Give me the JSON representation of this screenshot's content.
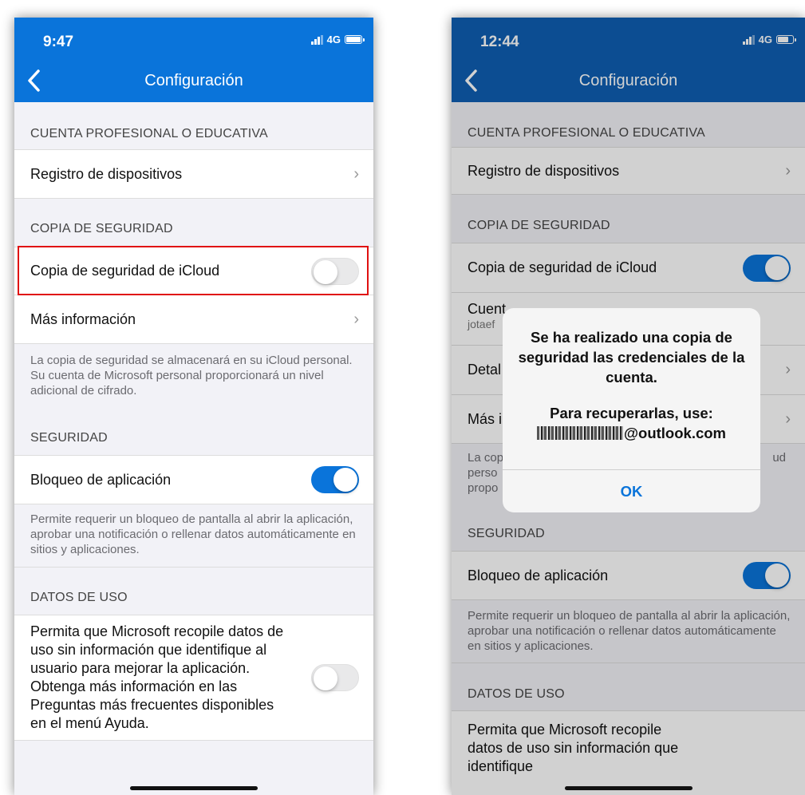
{
  "left": {
    "status": {
      "time": "9:47",
      "network": "4G"
    },
    "title": "Configuración",
    "section_work": "CUENTA PROFESIONAL O EDUCATIVA",
    "device_registration": "Registro de dispositivos",
    "section_backup": "COPIA DE SEGURIDAD",
    "icloud_backup": "Copia de seguridad de iCloud",
    "icloud_backup_on": false,
    "more_info": "Más información",
    "backup_note": "La copia de seguridad se almacenará en su iCloud personal. Su cuenta de Microsoft personal proporcionará un nivel adicional de cifrado.",
    "section_security": "SEGURIDAD",
    "app_lock": "Bloqueo de aplicación",
    "app_lock_on": true,
    "app_lock_note": "Permite requerir un bloqueo de pantalla al abrir la aplicación, aprobar una notificación o rellenar datos automáticamente en sitios y aplicaciones.",
    "section_usage": "DATOS DE USO",
    "usage_text": "Permita que Microsoft recopile datos de uso sin información que identifique al usuario para mejorar la aplicación. Obtenga más información en las Preguntas más frecuentes disponibles en el menú Ayuda.",
    "usage_on": false
  },
  "right": {
    "status": {
      "time": "12:44",
      "network": "4G"
    },
    "title": "Configuración",
    "section_work": "CUENTA PROFESIONAL O EDUCATIVA",
    "device_registration": "Registro de dispositivos",
    "section_backup": "COPIA DE SEGURIDAD",
    "icloud_backup": "Copia de seguridad de iCloud",
    "icloud_backup_on": true,
    "recovery_label": "Cuent",
    "recovery_value": "jotaef",
    "details_label": "Detal",
    "more_info_label": "Más i",
    "backup_note_left": "La cop\nperso\npropo",
    "backup_note_right": "ud",
    "section_security": "SEGURIDAD",
    "app_lock": "Bloqueo de aplicación",
    "app_lock_on": true,
    "app_lock_note": "Permite requerir un bloqueo de pantalla al abrir la aplicación, aprobar una notificación o rellenar datos automáticamente en sitios y aplicaciones.",
    "section_usage": "DATOS DE USO",
    "usage_text": "Permita que Microsoft recopile datos de uso sin información que identifique",
    "alert": {
      "title": "Se ha realizado una copia de seguridad las credenciales de la cuenta.",
      "message": "Para recuperarlas, use:",
      "email_domain": "@outlook.com",
      "ok": "OK"
    }
  },
  "colors": {
    "accent": "#0a74da",
    "highlight": "#e01010"
  }
}
